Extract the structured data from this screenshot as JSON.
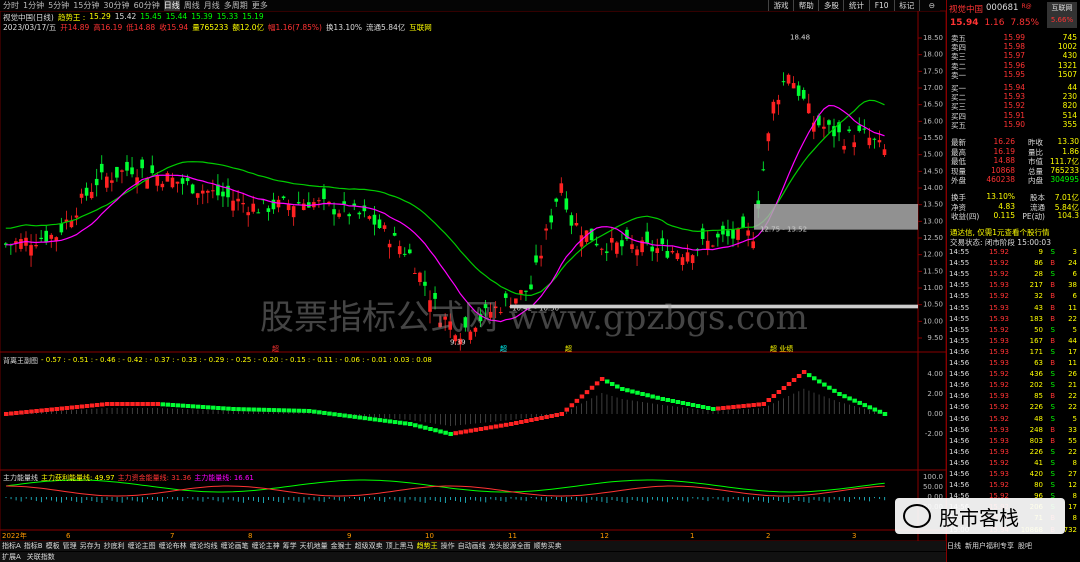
{
  "topbar": {
    "items": [
      "分时",
      "1分钟",
      "5分钟",
      "15分钟",
      "30分钟",
      "60分钟",
      "日线",
      "周线",
      "月线",
      "多周期",
      "更多"
    ],
    "active": "日线"
  },
  "toolbar": [
    "游戏",
    "帮助",
    "多股",
    "统计",
    "F10",
    "标记",
    "⊖"
  ],
  "info1": {
    "name": "视觉中国(日线)",
    "ind": "趋势王 :",
    "v1": "15.29",
    "v2": "15.42",
    "v3": "15.45",
    "v4": "15.44",
    "v5": "15.39",
    "v6": "15.33",
    "v7": "15.19"
  },
  "info2": {
    "date": "2023/03/17/五",
    "open": "开14.89",
    "high": "高16.19",
    "low": "低14.88",
    "close": "收15.94",
    "vol": "量765233",
    "amt": "额12.0亿",
    "chg": "幅1.16(7.85%)",
    "turn": "换13.10%",
    "flow": "流通5.84亿",
    "tag": "互联网"
  },
  "main_axis": [
    "18.50",
    "18.00",
    "17.50",
    "17.00",
    "16.50",
    "16.00",
    "15.50",
    "15.00",
    "14.50",
    "14.00",
    "13.50",
    "13.00",
    "12.50",
    "12.00",
    "11.50",
    "11.00",
    "10.50",
    "10.00",
    "9.50"
  ],
  "annotations": {
    "high": "18.48",
    "low": "9.39",
    "zone1": "12.75 - 13.52",
    "zone2": "10.42 - 10.50"
  },
  "markers": [
    "超",
    "超",
    "超",
    "超 业绩"
  ],
  "sub1": {
    "name": "背离王副图",
    "values": "- 0.57 : - 0.51 : - 0.46 : - 0.42 : - 0.37 : - 0.33 : - 0.29 : - 0.25 : - 0.20 : - 0.15 : - 0.11 : - 0.06 : - 0.01 : 0.03 : 0.08",
    "axis": [
      "4.00",
      "2.00",
      "0.00",
      "-2.00"
    ]
  },
  "sub2": {
    "name": "主力能量线",
    "a": "主力获利能量线: 49.97",
    "b": "主力资金能量线: 31.36",
    "c": "主力能量线: 16.61",
    "axis": [
      "100.0",
      "50.00",
      "0.00",
      "-50.00"
    ]
  },
  "date_axis": [
    "2022年",
    "6",
    "7",
    "8",
    "9",
    "10",
    "11",
    "12",
    "1",
    "2",
    "3"
  ],
  "panel": {
    "title": "视觉中国",
    "code": "000681",
    "flag": "R@",
    "price": "15.94",
    "chg": "1.16",
    "pct": "7.85%",
    "btn": "互联网",
    "btn_pct": "5.66%",
    "asks": [
      [
        "卖五",
        "15.99",
        "745"
      ],
      [
        "卖四",
        "15.98",
        "1002"
      ],
      [
        "卖三",
        "15.97",
        "430"
      ],
      [
        "卖二",
        "15.96",
        "1321"
      ],
      [
        "卖一",
        "15.95",
        "1507"
      ]
    ],
    "bids": [
      [
        "买一",
        "15.94",
        "44"
      ],
      [
        "买二",
        "15.93",
        "230"
      ],
      [
        "买三",
        "15.92",
        "820"
      ],
      [
        "买四",
        "15.91",
        "514"
      ],
      [
        "买五",
        "15.90",
        "355"
      ]
    ],
    "stats": [
      [
        "最新",
        "16.26",
        "昨收",
        "13.30"
      ],
      [
        "最高",
        "16.19",
        "量比",
        "1.86"
      ],
      [
        "最低",
        "14.88",
        "市值",
        "111.7亿"
      ],
      [
        "现量",
        "10868",
        "总量",
        "765233"
      ],
      [
        "外盘",
        "460238",
        "内盘",
        "304995"
      ]
    ],
    "stats2": [
      [
        "换手",
        "13.10%",
        "股本",
        "7.01亿"
      ],
      [
        "净资",
        "4.83",
        "流通",
        "5.84亿"
      ],
      [
        "收益(四)",
        "0.115",
        "PE(动)",
        "104.3"
      ]
    ],
    "notice": "通达信, 仅需1元查看个股行情",
    "status": "交易状态: 闭市阶段 15:00:03",
    "trades": [
      [
        "14:55",
        "15.92",
        "9",
        "S",
        "3"
      ],
      [
        "14:55",
        "15.92",
        "86",
        "B",
        "24"
      ],
      [
        "14:55",
        "15.92",
        "28",
        "S",
        "6"
      ],
      [
        "14:55",
        "15.93",
        "217",
        "B",
        "38"
      ],
      [
        "14:55",
        "15.92",
        "32",
        "B",
        "6"
      ],
      [
        "14:55",
        "15.93",
        "43",
        "B",
        "11"
      ],
      [
        "14:55",
        "15.93",
        "183",
        "B",
        "22"
      ],
      [
        "14:55",
        "15.92",
        "50",
        "S",
        "5"
      ],
      [
        "14:55",
        "15.93",
        "167",
        "B",
        "44"
      ],
      [
        "14:56",
        "15.93",
        "171",
        "S",
        "17"
      ],
      [
        "14:56",
        "15.93",
        "63",
        "B",
        "11"
      ],
      [
        "14:56",
        "15.92",
        "436",
        "S",
        "26"
      ],
      [
        "14:56",
        "15.92",
        "202",
        "S",
        "21"
      ],
      [
        "14:56",
        "15.93",
        "85",
        "B",
        "22"
      ],
      [
        "14:56",
        "15.92",
        "226",
        "S",
        "22"
      ],
      [
        "14:56",
        "15.92",
        "48",
        "S",
        "5"
      ],
      [
        "14:56",
        "15.93",
        "248",
        "B",
        "33"
      ],
      [
        "14:56",
        "15.93",
        "803",
        "B",
        "55"
      ],
      [
        "14:56",
        "15.93",
        "226",
        "S",
        "22"
      ],
      [
        "14:56",
        "15.92",
        "41",
        "S",
        "8"
      ],
      [
        "14:56",
        "15.93",
        "420",
        "S",
        "27"
      ],
      [
        "14:56",
        "15.92",
        "80",
        "S",
        "12"
      ],
      [
        "14:56",
        "15.92",
        "96",
        "S",
        "8"
      ],
      [
        "14:56",
        "15.92",
        "206",
        "S",
        "17"
      ],
      [
        "14:56",
        "15.93",
        "71",
        "B",
        "8"
      ],
      [
        "15:00",
        "15.94",
        "10868",
        "B",
        "732"
      ]
    ],
    "tabs": [
      "日线",
      "新用户福利专享",
      "股吧"
    ]
  },
  "bottombar": [
    "指标A",
    "指标B",
    "模板",
    "管理",
    "另存为",
    "抄底利",
    "缠论主图",
    "缠论布林",
    "缠论均线",
    "缠论画笔",
    "缠论主神",
    "筹学",
    "天机地量",
    "金猴士",
    "超级双卖",
    "顶上黑马",
    "趋势王",
    "操作",
    "自动画线",
    "龙头股源全面",
    "顺势买卖"
  ],
  "bottombar_sel": "趋势王",
  "bottombar2": [
    "扩展A",
    "关联指数"
  ],
  "watermark": "股票指标公式网 www.gpzbgs.com",
  "wechat": "股市客栈",
  "colors": {
    "up": "#ff2222",
    "down": "#00ff33",
    "ma": "#ff00ff",
    "band": "#00cc00",
    "bg": "#000000"
  }
}
